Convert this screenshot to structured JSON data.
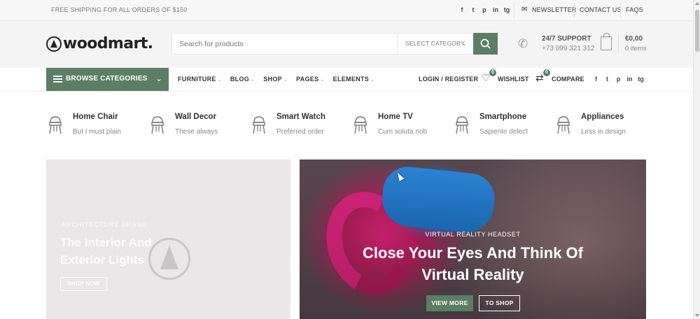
{
  "topbar": {
    "shipping": "FREE SHIPPING FOR ALL ORDERS OF $150",
    "social": [
      "f",
      "t",
      "p",
      "in",
      "tg"
    ],
    "links": {
      "newsletter": "NEWSLETTER",
      "contact": "CONTACT US",
      "faqs": "FAQS"
    }
  },
  "header": {
    "logo": "woodmart.",
    "search_placeholder": "Search for products",
    "category_select": "SELECT CATEGORY",
    "support_title": "24/7 SUPPORT",
    "support_phone": "+73 099 321 312",
    "cart_price": "€0,00",
    "cart_items": "0 items"
  },
  "nav": {
    "browse": "BROWSE CATEGORIES",
    "menu": [
      "FURNITURE",
      "BLOG",
      "SHOP",
      "PAGES",
      "ELEMENTS"
    ],
    "login": "LOGIN / REGISTER",
    "wishlist": "WISHLIST",
    "wishlist_count": "0",
    "compare": "COMPARE",
    "compare_count": "0",
    "social": [
      "f",
      "t",
      "p",
      "in",
      "tg"
    ]
  },
  "categories": [
    {
      "name": "Home Chair",
      "sub": "But I must plain"
    },
    {
      "name": "Wall Decor",
      "sub": "These always"
    },
    {
      "name": "Smart Watch",
      "sub": "Preferred order"
    },
    {
      "name": "Home TV",
      "sub": "Cum soluta nob"
    },
    {
      "name": "Smartphone",
      "sub": "Sapiente delect"
    },
    {
      "name": "Appliances",
      "sub": "Less in design"
    }
  ],
  "banner_left": {
    "tag": "ARCHITECTURE BRAND",
    "title": "The Interior And Exterior Lights",
    "button": "SHOP NOW"
  },
  "banner_right": {
    "tag": "VIRTUAL REALITY HEADSET",
    "title": "Close Your Eyes And Think Of Virtual Reality",
    "button_primary": "VIEW MORE",
    "button_secondary": "TO SHOP"
  },
  "colors": {
    "accent": "#5a7f64"
  }
}
